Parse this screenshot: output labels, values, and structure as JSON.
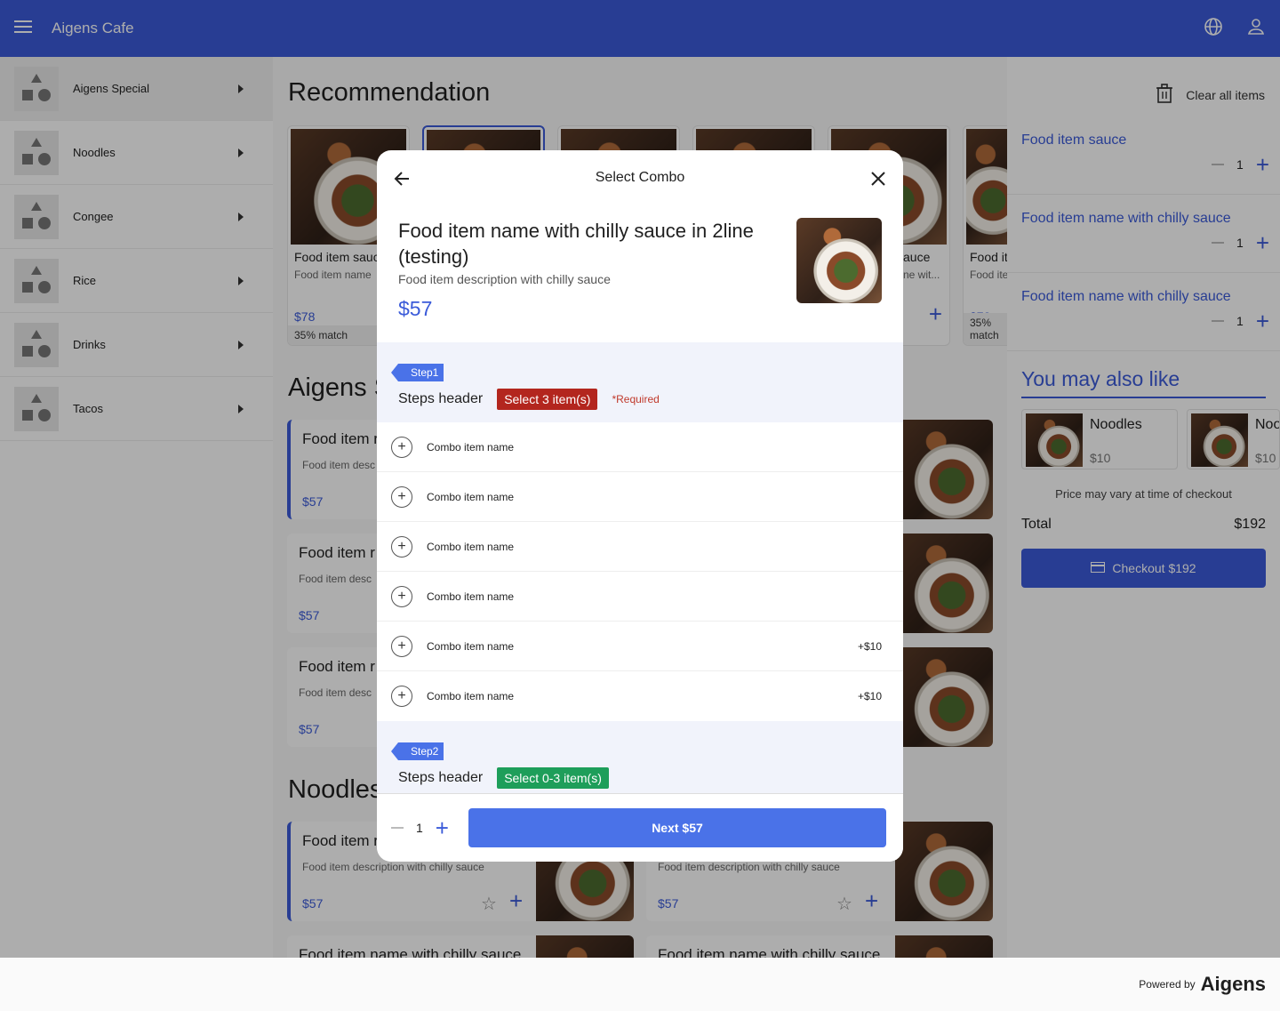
{
  "appbar": {
    "title": "Aigens Cafe"
  },
  "categories": [
    {
      "label": "Aigens Special"
    },
    {
      "label": "Noodles"
    },
    {
      "label": "Congee"
    },
    {
      "label": "Rice"
    },
    {
      "label": "Drinks"
    },
    {
      "label": "Tacos"
    }
  ],
  "main": {
    "recommendation_title": "Recommendation",
    "special_title": "Aigens S",
    "noodles_title": "Noodles",
    "rec_cards": [
      {
        "name": "Food item sauce",
        "desc": "Food item name",
        "price": "$78",
        "match": "35% match"
      },
      {
        "name": "Food item",
        "desc": "Food item",
        "price": "$78",
        "match": "35% match"
      }
    ],
    "rec_partial": {
      "name": "auce",
      "desc": "ne wit..."
    },
    "list_cards": [
      {
        "name": "Food item r",
        "desc": "Food item desc",
        "price": "$57"
      },
      {
        "name": "Food item r",
        "desc": "Food item desc",
        "price": "$57"
      },
      {
        "name": "Food item r",
        "desc": "Food item desc",
        "price": "$57"
      }
    ],
    "noodle_cards": [
      {
        "name": "Food item r",
        "desc": "Food item description with chilly sauce",
        "price": "$57"
      },
      {
        "name": "",
        "desc": "Food item description with chilly sauce",
        "price": "$57"
      }
    ],
    "bottom_names": [
      "Food item name with chilly sauce",
      "Food item name with chilly sauce"
    ]
  },
  "modal": {
    "title": "Select Combo",
    "item_name": "Food item name with chilly sauce in 2line (testing)",
    "item_desc": "Food item description with chilly sauce",
    "item_price": "$57",
    "step1": {
      "tag": "Step1",
      "header": "Steps header",
      "badge": "Select 3 item(s)",
      "required": "*Required"
    },
    "options": [
      {
        "name": "Combo item name",
        "extra": ""
      },
      {
        "name": "Combo item name",
        "extra": ""
      },
      {
        "name": "Combo item name",
        "extra": ""
      },
      {
        "name": "Combo item name",
        "extra": ""
      },
      {
        "name": "Combo item name",
        "extra": "+$10"
      },
      {
        "name": "Combo item name",
        "extra": "+$10"
      }
    ],
    "step2": {
      "tag": "Step2",
      "header": "Steps header",
      "badge": "Select 0-3 item(s)"
    },
    "qty": "1",
    "next_label": "Next $57"
  },
  "cart": {
    "clear_label": "Clear all items",
    "items": [
      {
        "name": "Food item sauce",
        "qty": "1"
      },
      {
        "name": "Food item name with chilly sauce",
        "qty": "1"
      },
      {
        "name": "Food item name with chilly sauce",
        "qty": "1"
      }
    ],
    "also_like_title": "You may also like",
    "also_like": [
      {
        "name": "Noodles",
        "price": "$10"
      },
      {
        "name": "Noo",
        "price": "$10"
      }
    ],
    "price_note": "Price may vary at time of checkout",
    "total_label": "Total",
    "total_value": "$192",
    "checkout_label": "Checkout $192"
  },
  "footer": {
    "powered": "Powered by",
    "brand": "Aigens"
  },
  "colors": {
    "primary": "#3b5bd9",
    "button": "#4a72e8",
    "required_badge": "#b3261e",
    "optional_badge": "#1e9e5a"
  }
}
